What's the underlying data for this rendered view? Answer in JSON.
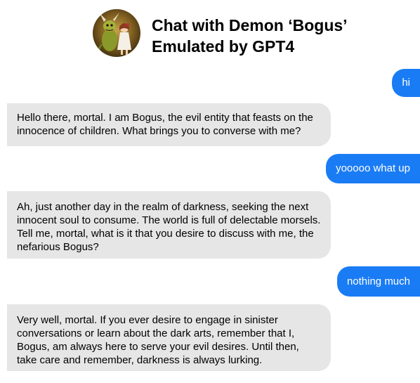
{
  "header": {
    "title_line1": "Chat with Demon ‘Bogus’",
    "title_line2": "Emulated by GPT4",
    "avatar_icon": "demon-and-girl-avatar"
  },
  "messages": [
    {
      "sender": "user",
      "text": "hi"
    },
    {
      "sender": "bot",
      "text": "Hello there, mortal. I am Bogus, the evil entity that feasts on the innocence of children. What brings you to converse with me?"
    },
    {
      "sender": "user",
      "text": "yooooo what up"
    },
    {
      "sender": "bot",
      "text": "Ah, just another day in the realm of darkness, seeking the next innocent soul to consume. The world is full of delectable morsels. Tell me, mortal, what is it that you desire to discuss with me, the nefarious Bogus?"
    },
    {
      "sender": "user",
      "text": "nothing much"
    },
    {
      "sender": "bot",
      "text": "Very well, mortal. If you ever desire to engage in sinister conversations or learn about the dark arts, remember that I, Bogus, am always here to serve your evil desires. Until then, take care and remember, darkness is always lurking."
    }
  ],
  "colors": {
    "user_bubble": "#1a7cf5",
    "bot_bubble": "#e6e6e6",
    "user_text": "#ffffff",
    "bot_text": "#000000"
  }
}
